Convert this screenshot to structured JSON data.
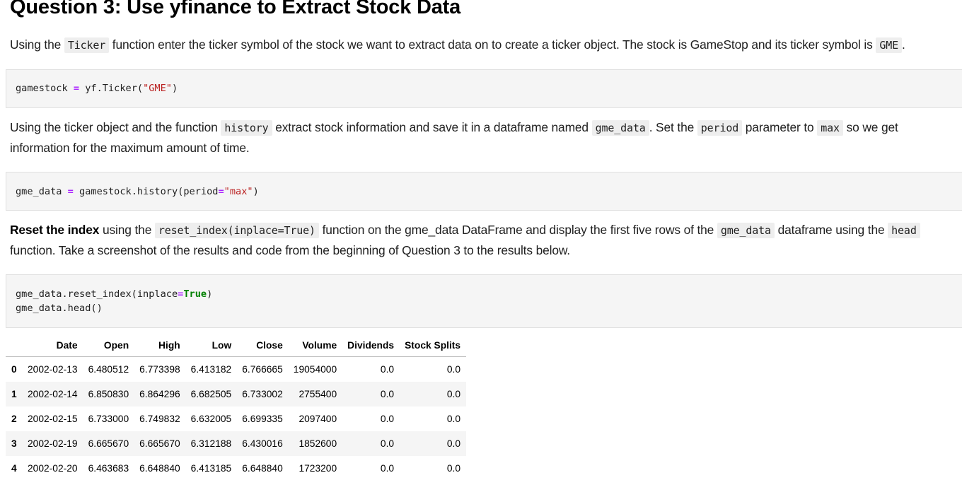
{
  "heading": "Question 3: Use yfinance to Extract Stock Data",
  "para1": {
    "t1": "Using the ",
    "c1": "Ticker",
    "t2": " function enter the ticker symbol of the stock we want to extract data on to create a ticker object. The stock is GameStop and its ticker symbol is ",
    "c2": "GME",
    "t3": "."
  },
  "cell1": {
    "var": "gamestock ",
    "op": "=",
    "rest": " yf.Ticker(",
    "str": "\"GME\"",
    "close": ")"
  },
  "para2": {
    "t1": "Using the ticker object and the function ",
    "c1": "history",
    "t2": " extract stock information and save it in a dataframe named ",
    "c2": "gme_data",
    "t3": ". Set the ",
    "c3": "period",
    "t4": " parameter to ",
    "c4": "max",
    "t5": " so we get information for the maximum amount of time."
  },
  "cell2": {
    "var": "gme_data ",
    "op": "=",
    "rest": " gamestock.history(period",
    "op2": "=",
    "str": "\"max\"",
    "close": ")"
  },
  "para3": {
    "bold": "Reset the index",
    "t1": " using the ",
    "c1": "reset_index(inplace=True)",
    "t2": " function on the gme_data DataFrame and display the first five rows of the ",
    "c2": "gme_data",
    "t3": " dataframe using the ",
    "c3": "head",
    "t4": " function. Take a screenshot of the results and code from the beginning of Question 3 to the results below."
  },
  "cell3": {
    "line1a": "gme_data.reset_index(inplace",
    "op": "=",
    "kw": "True",
    "line1b": ")",
    "line2": "gme_data.head()"
  },
  "table": {
    "columns": [
      "Date",
      "Open",
      "High",
      "Low",
      "Close",
      "Volume",
      "Dividends",
      "Stock Splits"
    ],
    "rows": [
      {
        "index": "0",
        "cells": [
          "2002-02-13",
          "6.480512",
          "6.773398",
          "6.413182",
          "6.766665",
          "19054000",
          "0.0",
          "0.0"
        ]
      },
      {
        "index": "1",
        "cells": [
          "2002-02-14",
          "6.850830",
          "6.864296",
          "6.682505",
          "6.733002",
          "2755400",
          "0.0",
          "0.0"
        ]
      },
      {
        "index": "2",
        "cells": [
          "2002-02-15",
          "6.733000",
          "6.749832",
          "6.632005",
          "6.699335",
          "2097400",
          "0.0",
          "0.0"
        ]
      },
      {
        "index": "3",
        "cells": [
          "2002-02-19",
          "6.665670",
          "6.665670",
          "6.312188",
          "6.430016",
          "1852600",
          "0.0",
          "0.0"
        ]
      },
      {
        "index": "4",
        "cells": [
          "2002-02-20",
          "6.463683",
          "6.648840",
          "6.413185",
          "6.648840",
          "1723200",
          "0.0",
          "0.0"
        ]
      }
    ]
  }
}
